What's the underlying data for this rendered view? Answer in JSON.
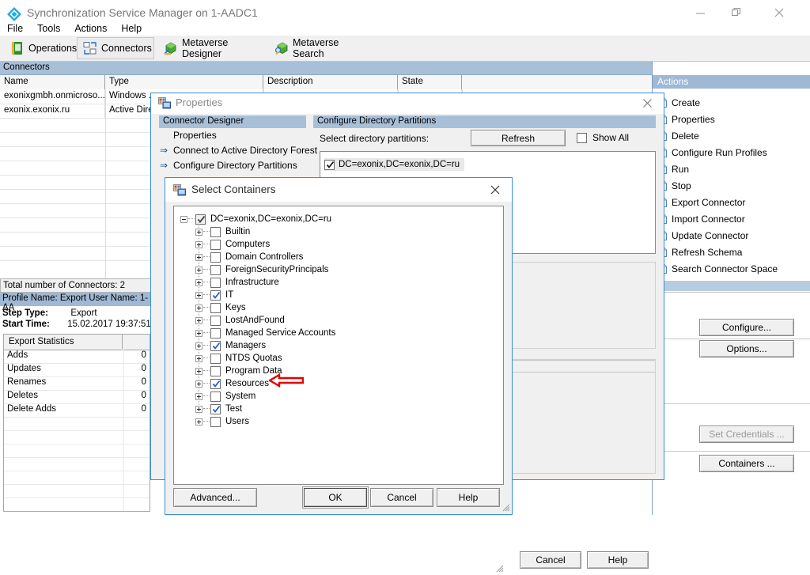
{
  "window": {
    "title": "Synchronization Service Manager on 1-AADC1",
    "icon": "sync-service-icon",
    "minimize_label": "Minimize",
    "maximize_label": "Restore",
    "close_label": "Close"
  },
  "menu": [
    "File",
    "Tools",
    "Actions",
    "Help"
  ],
  "toolbar": [
    {
      "label": "Operations",
      "icon": "operations-icon",
      "selected": false
    },
    {
      "label": "Connectors",
      "icon": "connectors-icon",
      "selected": true
    },
    {
      "label": "Metaverse Designer",
      "icon": "metaverse-designer-icon",
      "selected": false
    },
    {
      "label": "Metaverse Search",
      "icon": "metaverse-search-icon",
      "selected": false
    }
  ],
  "connectors_pane": {
    "band_label": "Connectors",
    "columns": [
      "Name",
      "Type",
      "Description",
      "State"
    ],
    "rows": [
      {
        "name": "exonixgmbh.onmicroso...",
        "type": "Windows ...",
        "description": "",
        "state": ""
      },
      {
        "name": "exonix.exonix.ru",
        "type": "Active Dire...",
        "description": "",
        "state": ""
      }
    ],
    "total_label": "Total number of Connectors: 2"
  },
  "profile": {
    "header": "Profile Name: Export  User Name: 1-AA",
    "step_type_label": "Step Type:",
    "step_type_value": "Export",
    "start_time_label": "Start Time:",
    "start_time_value": "15.02.2017 19:37:51"
  },
  "statistics": {
    "header": "Export Statistics",
    "rows": [
      {
        "name": "Adds",
        "value": "0"
      },
      {
        "name": "Updates",
        "value": "0"
      },
      {
        "name": "Renames",
        "value": "0"
      },
      {
        "name": "Deletes",
        "value": "0"
      },
      {
        "name": "Delete Adds",
        "value": "0"
      }
    ]
  },
  "actions": {
    "header": "Actions",
    "items": [
      "Create",
      "Properties",
      "Delete",
      "Configure Run Profiles",
      "Run",
      "Stop",
      "Export Connector",
      "Import Connector",
      "Update Connector",
      "Refresh Schema",
      "Search Connector Space"
    ]
  },
  "properties_dialog": {
    "title": "Properties",
    "icon": "properties-icon",
    "close_label": "Close",
    "nav_header": "Connector Designer",
    "nav_items": [
      {
        "label": "Properties",
        "current": false
      },
      {
        "label": "Connect to Active Directory Forest",
        "current": false
      },
      {
        "label": "Configure Directory Partitions",
        "current": true
      }
    ],
    "content_header": "Configure Directory Partitions",
    "select_partitions_label": "Select directory partitions:",
    "refresh_label": "Refresh",
    "show_all_label": "Show All",
    "show_all_checked": false,
    "partitions": [
      {
        "label": "DC=exonix,DC=exonix,DC=ru",
        "checked": true,
        "selected": true
      }
    ],
    "configure_label": "Configure...",
    "options_label": "Options...",
    "set_credentials_label": "Set Credentials ...",
    "set_credentials_enabled": false,
    "containers_label": "Containers ...",
    "cancel_label": "Cancel",
    "help_label": "Help"
  },
  "select_containers_dialog": {
    "title": "Select Containers",
    "icon": "select-containers-icon",
    "close_label": "Close",
    "tree": {
      "root": {
        "label": "DC=exonix,DC=exonix,DC=ru",
        "checked": true,
        "partial": true,
        "expanded": true
      },
      "children": [
        {
          "label": "Builtin",
          "checked": false
        },
        {
          "label": "Computers",
          "checked": false
        },
        {
          "label": "Domain Controllers",
          "checked": false
        },
        {
          "label": "ForeignSecurityPrincipals",
          "checked": false
        },
        {
          "label": "Infrastructure",
          "checked": false
        },
        {
          "label": "IT",
          "checked": true
        },
        {
          "label": "Keys",
          "checked": false
        },
        {
          "label": "LostAndFound",
          "checked": false
        },
        {
          "label": "Managed Service Accounts",
          "checked": false
        },
        {
          "label": "Managers",
          "checked": true
        },
        {
          "label": "NTDS Quotas",
          "checked": false
        },
        {
          "label": "Program Data",
          "checked": false
        },
        {
          "label": "Resources",
          "checked": true
        },
        {
          "label": "System",
          "checked": false
        },
        {
          "label": "Test",
          "checked": true
        },
        {
          "label": "Users",
          "checked": false
        }
      ]
    },
    "advanced_label": "Advanced...",
    "ok_label": "OK",
    "cancel_label": "Cancel",
    "help_label": "Help"
  },
  "annotation": {
    "arrow_color": "#e60000",
    "points_to": "Resources"
  }
}
